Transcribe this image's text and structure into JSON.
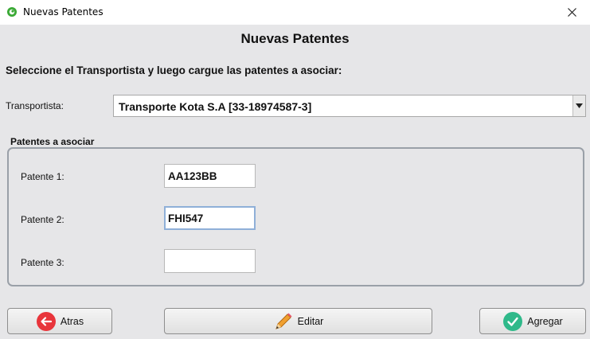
{
  "window": {
    "title": "Nuevas Patentes"
  },
  "dialog": {
    "heading": "Nuevas Patentes",
    "instruction": "Seleccione el Transportista y luego cargue las patentes a asociar:"
  },
  "transportista": {
    "label": "Transportista:",
    "selected": "Transporte Kota S.A [33-18974587-3]"
  },
  "patentes": {
    "group_title": "Patentes a asociar",
    "fields": [
      {
        "label": "Patente 1:",
        "value": "AA123BB"
      },
      {
        "label": "Patente 2:",
        "value": "FHI547"
      },
      {
        "label": "Patente 3:",
        "value": ""
      }
    ]
  },
  "buttons": {
    "back": {
      "label": "Atras",
      "icon": "arrow-left-icon",
      "color": "#e8353b"
    },
    "edit": {
      "label": "Editar",
      "icon": "pencil-icon",
      "color": "#f0a030"
    },
    "add": {
      "label": "Agregar",
      "icon": "checkmark-icon",
      "color": "#2fb98a"
    }
  }
}
